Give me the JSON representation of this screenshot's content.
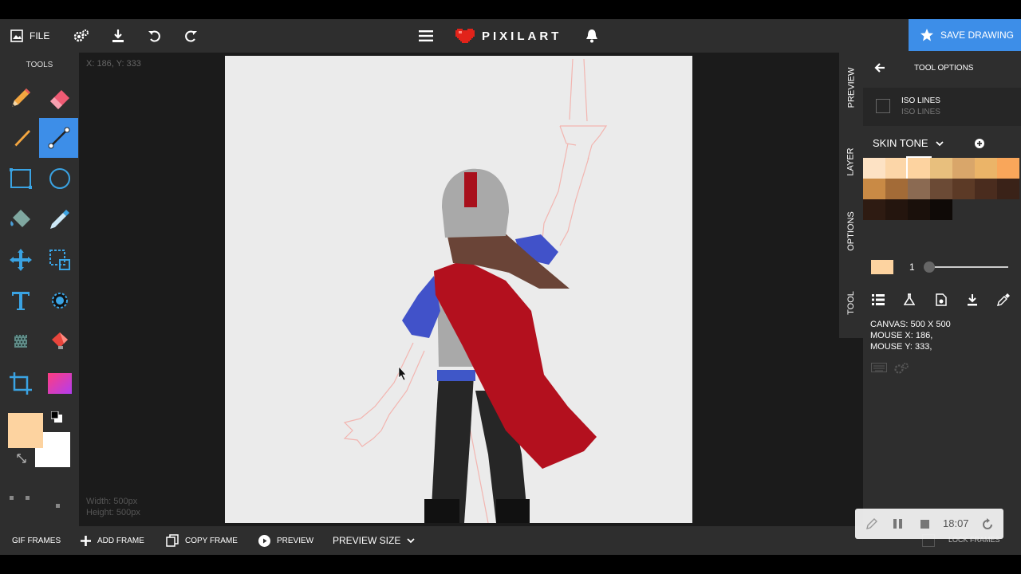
{
  "topbar": {
    "file_label": "FILE",
    "logo_text": "PIXILART",
    "save_label": "SAVE DRAWING"
  },
  "tools": {
    "title": "TOOLS",
    "items": [
      "pencil",
      "eraser",
      "brush",
      "line",
      "rectangle",
      "circle",
      "fill-bucket",
      "eyedropper",
      "move",
      "select",
      "text",
      "lighten",
      "dither",
      "bucket-alt",
      "crop",
      "gradient"
    ],
    "active": "line",
    "primary_color": "#fdd3a0",
    "secondary_color": "#ffffff"
  },
  "canvas": {
    "coords_text": "X: 186, Y: 333",
    "width_text": "Width: 500px",
    "height_text": "Height: 500px"
  },
  "side_tabs": [
    "PREVIEW",
    "LAYER",
    "OPTIONS",
    "TOOL"
  ],
  "panel": {
    "title": "TOOL OPTIONS",
    "iso_label": "ISO LINES",
    "iso_sub": "ISO LINES",
    "palette_name": "SKIN TONE",
    "palette_colors": [
      "#fde2c4",
      "#fcd6a8",
      "#fdd3a0",
      "#e8bf7d",
      "#d9a66a",
      "#ebb468",
      "#f9a65a",
      "#c98a45",
      "#a36b37",
      "#8b6a52",
      "#6b4a35",
      "#5c3a26",
      "#4a2c1e",
      "#3a2218",
      "#2e1b12",
      "#24150e",
      "#1a100b",
      "#0f0a07"
    ],
    "brush_color": "#fdd3a0",
    "brush_size": "1",
    "canvas_info": "CANVAS: 500 X 500",
    "mouse_x": "MOUSE X: 186,",
    "mouse_y": "MOUSE Y: 333,"
  },
  "bottombar": {
    "gif_frames": "GIF FRAMES",
    "add_frame": "ADD FRAME",
    "copy_frame": "COPY FRAME",
    "preview": "PREVIEW",
    "preview_size": "PREVIEW SIZE",
    "lock_frames": "LOCK FRAMES"
  },
  "recorder": {
    "time": "18:07"
  }
}
